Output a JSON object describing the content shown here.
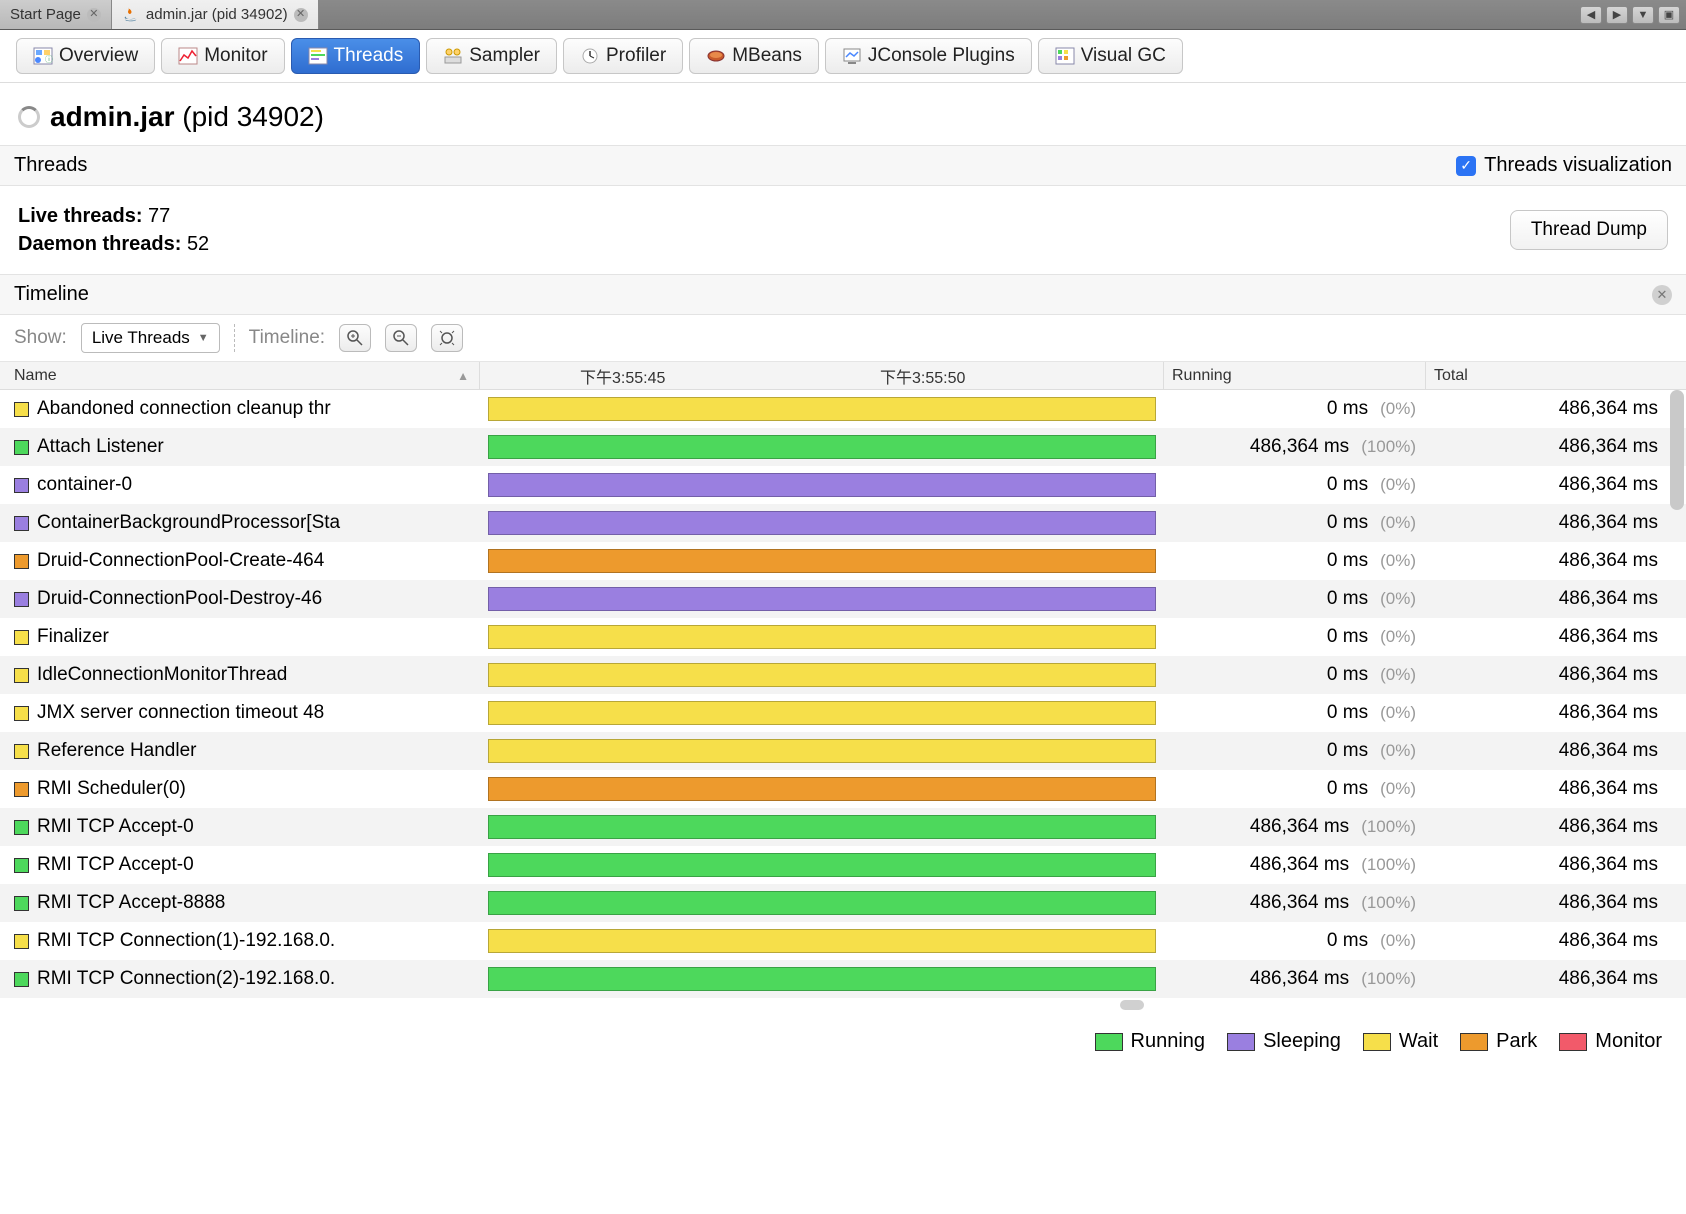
{
  "windowTabs": {
    "start": "Start Page",
    "active": "admin.jar (pid 34902)"
  },
  "toolbar": {
    "overview": "Overview",
    "monitor": "Monitor",
    "threads": "Threads",
    "sampler": "Sampler",
    "profiler": "Profiler",
    "mbeans": "MBeans",
    "jconsole": "JConsole Plugins",
    "visualgc": "Visual GC"
  },
  "title": {
    "name": "admin.jar",
    "pid": "(pid 34902)"
  },
  "sectionHeader": {
    "label": "Threads",
    "checkbox": "Threads visualization"
  },
  "stats": {
    "liveLabel": "Live threads:",
    "liveValue": "77",
    "daemonLabel": "Daemon threads:",
    "daemonValue": "52",
    "dumpButton": "Thread Dump"
  },
  "timelineHeader": "Timeline",
  "controls": {
    "showLabel": "Show:",
    "showValue": "Live Threads",
    "timelineLabel": "Timeline:"
  },
  "columns": {
    "name": "Name",
    "running": "Running",
    "total": "Total",
    "tick1": "下午3:55:45",
    "tick2": "下午3:55:50"
  },
  "legend": {
    "running": "Running",
    "sleeping": "Sleeping",
    "wait": "Wait",
    "park": "Park",
    "monitor": "Monitor"
  },
  "rows": [
    {
      "name": "Abandoned connection cleanup thr",
      "state": "wait",
      "running": "0 ms",
      "pct": "(0%)",
      "total": "486,364 ms"
    },
    {
      "name": "Attach Listener",
      "state": "running",
      "running": "486,364 ms",
      "pct": "(100%)",
      "total": "486,364 ms"
    },
    {
      "name": "container-0",
      "state": "sleeping",
      "running": "0 ms",
      "pct": "(0%)",
      "total": "486,364 ms"
    },
    {
      "name": "ContainerBackgroundProcessor[Sta",
      "state": "sleeping",
      "running": "0 ms",
      "pct": "(0%)",
      "total": "486,364 ms"
    },
    {
      "name": "Druid-ConnectionPool-Create-464",
      "state": "park",
      "running": "0 ms",
      "pct": "(0%)",
      "total": "486,364 ms"
    },
    {
      "name": "Druid-ConnectionPool-Destroy-46",
      "state": "sleeping",
      "running": "0 ms",
      "pct": "(0%)",
      "total": "486,364 ms"
    },
    {
      "name": "Finalizer",
      "state": "wait",
      "running": "0 ms",
      "pct": "(0%)",
      "total": "486,364 ms"
    },
    {
      "name": "IdleConnectionMonitorThread",
      "state": "wait",
      "running": "0 ms",
      "pct": "(0%)",
      "total": "486,364 ms"
    },
    {
      "name": "JMX server connection timeout 48",
      "state": "wait",
      "running": "0 ms",
      "pct": "(0%)",
      "total": "486,364 ms"
    },
    {
      "name": "Reference Handler",
      "state": "wait",
      "running": "0 ms",
      "pct": "(0%)",
      "total": "486,364 ms"
    },
    {
      "name": "RMI Scheduler(0)",
      "state": "park",
      "running": "0 ms",
      "pct": "(0%)",
      "total": "486,364 ms"
    },
    {
      "name": "RMI TCP Accept-0",
      "state": "running",
      "running": "486,364 ms",
      "pct": "(100%)",
      "total": "486,364 ms"
    },
    {
      "name": "RMI TCP Accept-0",
      "state": "running",
      "running": "486,364 ms",
      "pct": "(100%)",
      "total": "486,364 ms"
    },
    {
      "name": "RMI TCP Accept-8888",
      "state": "running",
      "running": "486,364 ms",
      "pct": "(100%)",
      "total": "486,364 ms"
    },
    {
      "name": "RMI TCP Connection(1)-192.168.0.",
      "state": "wait",
      "running": "0 ms",
      "pct": "(0%)",
      "total": "486,364 ms"
    },
    {
      "name": "RMI TCP Connection(2)-192.168.0.",
      "state": "running",
      "running": "486,364 ms",
      "pct": "(100%)",
      "total": "486,364 ms"
    }
  ]
}
